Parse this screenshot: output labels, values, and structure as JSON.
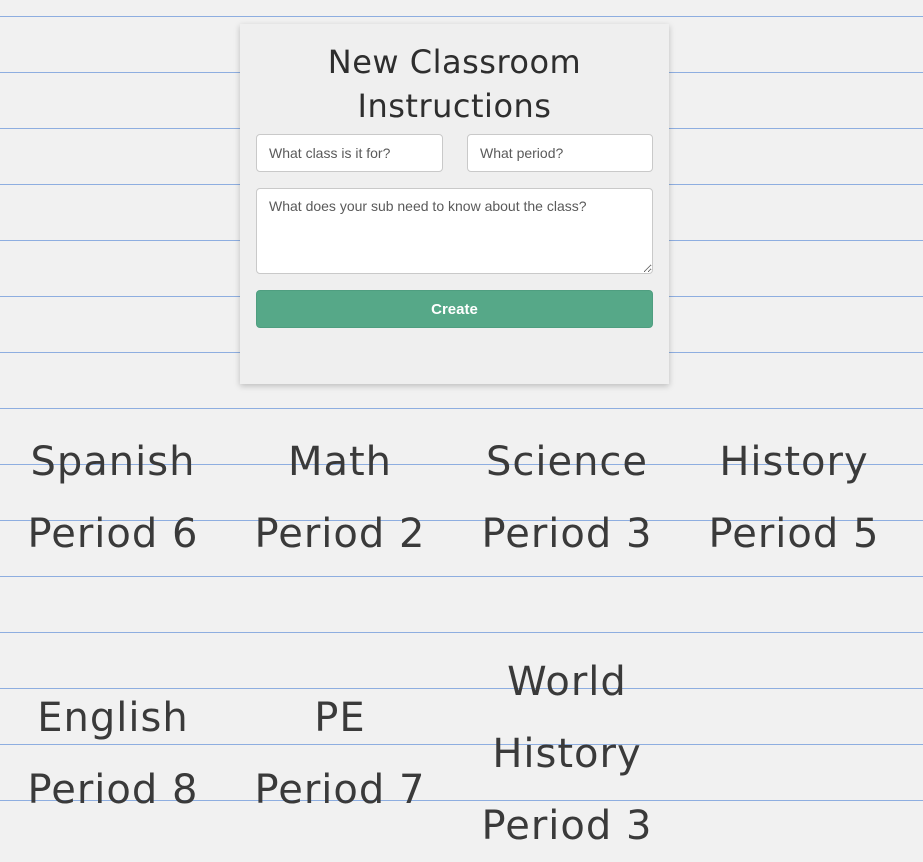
{
  "form": {
    "title": "New Classroom Instructions",
    "class_placeholder": "What class is it for?",
    "period_placeholder": "What period?",
    "notes_placeholder": "What does your sub need to know about the class?",
    "create_label": "Create"
  },
  "classes": [
    {
      "name": "Spanish",
      "period": "Period 6"
    },
    {
      "name": "Math",
      "period": "Period 2"
    },
    {
      "name": "Science",
      "period": "Period 3"
    },
    {
      "name": "History",
      "period": "Period 5"
    },
    {
      "name": "English",
      "period": "Period 8"
    },
    {
      "name": "PE",
      "period": "Period 7"
    },
    {
      "name": "World History",
      "period": "Period 3"
    }
  ],
  "colors": {
    "background": "#f1f1f1",
    "ruled_line": "#8eaee0",
    "button": "#56a888"
  }
}
